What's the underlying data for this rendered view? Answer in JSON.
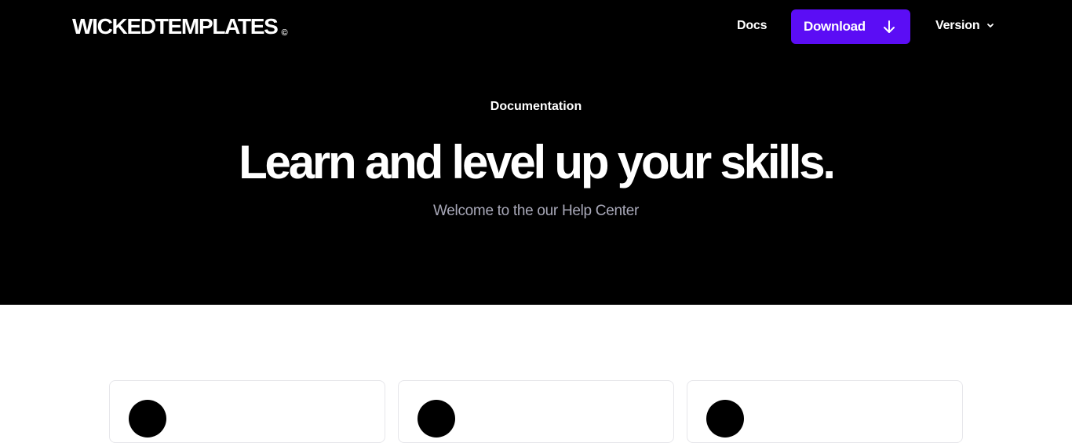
{
  "brand": {
    "name": "WICKEDTEMPLATES",
    "mark": "©"
  },
  "nav": {
    "docs_label": "Docs",
    "download_label": "Download",
    "download_icon": "arrow-down-icon",
    "version_label": "Version",
    "version_icon": "chevron-down-icon"
  },
  "hero": {
    "eyebrow": "Documentation",
    "title": "Learn and level up your skills.",
    "subtitle": "Welcome to the our Help Center"
  },
  "colors": {
    "hero_background": "#000000",
    "accent": "#5b0df5",
    "subtitle_text": "#a8a8b8",
    "card_border": "#e6e6ea"
  }
}
